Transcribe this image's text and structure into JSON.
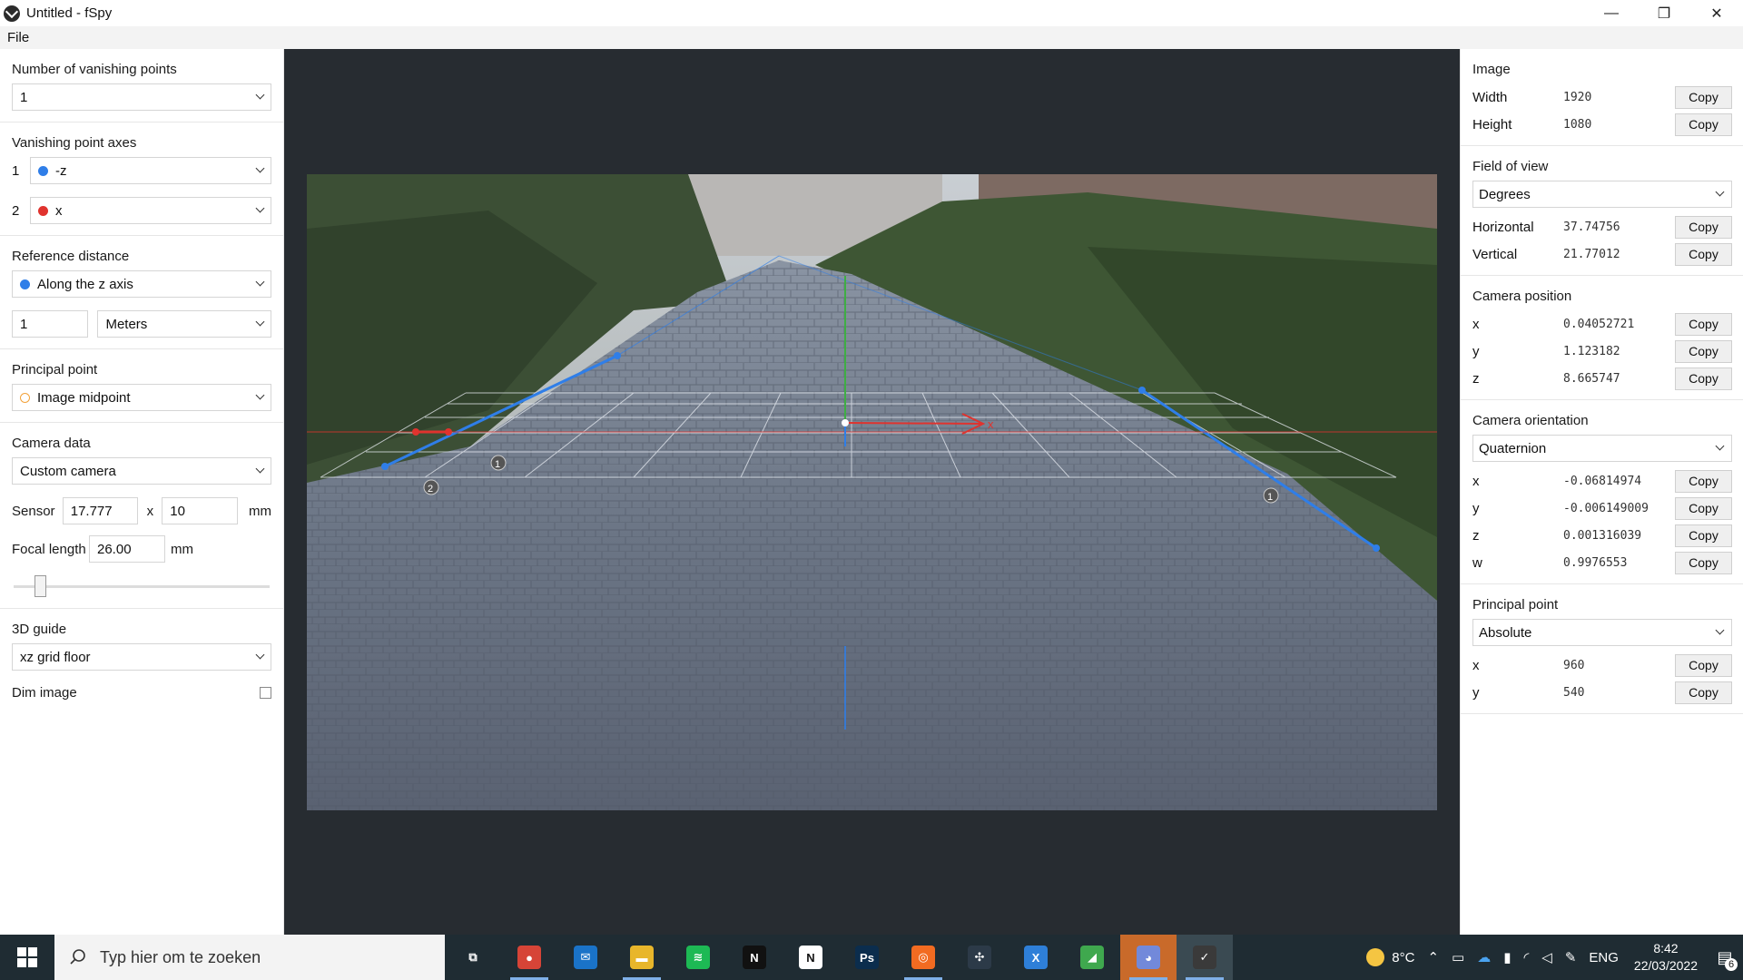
{
  "window": {
    "title": "Untitled - fSpy",
    "minimize": "—",
    "restore": "❐",
    "close": "✕"
  },
  "menu": {
    "file": "File"
  },
  "left": {
    "num_vp_title": "Number of vanishing points",
    "num_vp_value": "1",
    "vp_axes_title": "Vanishing point axes",
    "vp_axes": [
      {
        "num": "1",
        "label": "-z",
        "color": "#2f7ee8"
      },
      {
        "num": "2",
        "label": "x",
        "color": "#e0332e"
      }
    ],
    "ref_dist_title": "Reference distance",
    "ref_dist_axis": "Along the z axis",
    "ref_dist_value": "1",
    "ref_dist_unit": "Meters",
    "pp_title": "Principal point",
    "pp_value": "Image midpoint",
    "camera_title": "Camera data",
    "camera_value": "Custom camera",
    "sensor_label": "Sensor",
    "sensor_w": "17.777",
    "sensor_x": "x",
    "sensor_h": "10",
    "sensor_unit": "mm",
    "focal_label": "Focal length",
    "focal_value": "26.00",
    "focal_unit": "mm",
    "guide_title": "3D guide",
    "guide_value": "xz grid floor",
    "dim_label": "Dim image"
  },
  "right": {
    "image_title": "Image",
    "width_label": "Width",
    "width_value": "1920",
    "height_label": "Height",
    "height_value": "1080",
    "fov_title": "Field of view",
    "fov_unit": "Degrees",
    "hfov_label": "Horizontal",
    "hfov_value": "37.74756",
    "vfov_label": "Vertical",
    "vfov_value": "21.77012",
    "campos_title": "Camera position",
    "campos": [
      {
        "label": "x",
        "value": "0.04052721"
      },
      {
        "label": "y",
        "value": "1.123182"
      },
      {
        "label": "z",
        "value": "8.665747"
      }
    ],
    "camor_title": "Camera orientation",
    "camor_mode": "Quaternion",
    "camor": [
      {
        "label": "x",
        "value": "-0.06814974"
      },
      {
        "label": "y",
        "value": "-0.006149009"
      },
      {
        "label": "z",
        "value": "0.001316039"
      },
      {
        "label": "w",
        "value": "0.9976553"
      }
    ],
    "pp_title": "Principal point",
    "pp_mode": "Absolute",
    "pp": [
      {
        "label": "x",
        "value": "960"
      },
      {
        "label": "y",
        "value": "540"
      }
    ],
    "copy_label": "Copy"
  },
  "viewport": {
    "cp_one": "1",
    "cp_two": "2",
    "axis_x_label": "x"
  },
  "taskbar": {
    "search_placeholder": "Typ hier om te zoeken",
    "weather": "8°C",
    "lang": "ENG",
    "time": "8:42",
    "date": "22/03/2022",
    "notif_count": "6",
    "apps": [
      {
        "name": "task-view",
        "glyph": "⧉",
        "color": "transparent"
      },
      {
        "name": "chrome",
        "glyph": "●",
        "color": "#d64437"
      },
      {
        "name": "mail",
        "glyph": "✉",
        "color": "#1a73c8"
      },
      {
        "name": "file-explorer",
        "glyph": "▬",
        "color": "#e8b62b"
      },
      {
        "name": "spotify",
        "glyph": "≋",
        "color": "#1db954"
      },
      {
        "name": "netflix",
        "glyph": "N",
        "color": "#111111"
      },
      {
        "name": "notion",
        "glyph": "N",
        "color": "#ffffff"
      },
      {
        "name": "photoshop",
        "glyph": "Ps",
        "color": "#0b2d4d"
      },
      {
        "name": "houdini",
        "glyph": "◎",
        "color": "#f26b21"
      },
      {
        "name": "davinci-resolve",
        "glyph": "✣",
        "color": "#2c3a48"
      },
      {
        "name": "x-app",
        "glyph": "X",
        "color": "#2e7fd8"
      },
      {
        "name": "sketchbook",
        "glyph": "◢",
        "color": "#3fa84e"
      },
      {
        "name": "discord",
        "glyph": "◕",
        "color": "#7289da"
      },
      {
        "name": "fspy",
        "glyph": "✓",
        "color": "#3a3a3a"
      }
    ]
  },
  "colors": {
    "blue": "#2f7ee8",
    "red": "#e0332e",
    "viewport_bg": "#272c31"
  }
}
